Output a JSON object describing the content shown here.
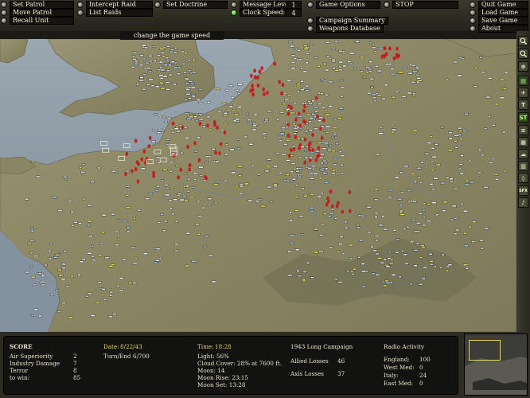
{
  "toolbar": {
    "set_patrol": "Set Patrol",
    "move_patrol": "Move Patrol",
    "recall_unit": "Recall Unit",
    "intercept_raid": "Intercept Raid",
    "list_raids": "List Raids",
    "set_doctrine": "Set Doctrine",
    "message_level_label": "Message Level:",
    "message_level_value": "1",
    "clock_speed_label": "Clock Speed:",
    "clock_speed_value": "4",
    "game_options": "Game Options",
    "campaign_summary": "Campaign Summary",
    "weapons_database": "Weapons Database",
    "stop": "STOP",
    "quit_game": "Quit Game",
    "load_game": "Load Game",
    "save_game": "Save Game",
    "about": "About"
  },
  "tooltip": "change the game speed",
  "tools": [
    "ST",
    "SFX"
  ],
  "score": {
    "heading": "SCORE",
    "rows": [
      {
        "label": "Air Superiority",
        "value": "2"
      },
      {
        "label": "Industry Damage",
        "value": "7"
      },
      {
        "label": "Terror",
        "value": "8"
      },
      {
        "label": "to win:",
        "value": "85"
      }
    ]
  },
  "dates": {
    "date_label": "Date:",
    "date_value": "8/22/43",
    "turn_label": "Turn/End",
    "turn_value": "6/700"
  },
  "weather": {
    "time_label": "Time:",
    "time_value": "18:28",
    "light": "Light: 56%",
    "cloud": "Cloud Cover: 28% at 7600 ft.",
    "moon": "Moon: 14",
    "moon_rise": "Moon Rise: 23:15",
    "moon_set": "Moon Set: 13:28"
  },
  "campaign": {
    "title": "1943 Long Campaign",
    "allied_label": "Allied Losses",
    "allied_value": "46",
    "axis_label": "Axis Losses",
    "axis_value": "37"
  },
  "radio": {
    "title": "Radio Activity",
    "rows": [
      {
        "label": "England:",
        "value": "100"
      },
      {
        "label": "West Med:",
        "value": "0"
      },
      {
        "label": "Italy:",
        "value": "24"
      },
      {
        "label": "East Med:",
        "value": "0"
      }
    ]
  },
  "colors": {
    "sea": "#8a97a2",
    "land": "#8d8867",
    "allied_unit": "#e6d75a",
    "axis_unit": "#c41f1f",
    "airfield": "#d8d8d8"
  }
}
